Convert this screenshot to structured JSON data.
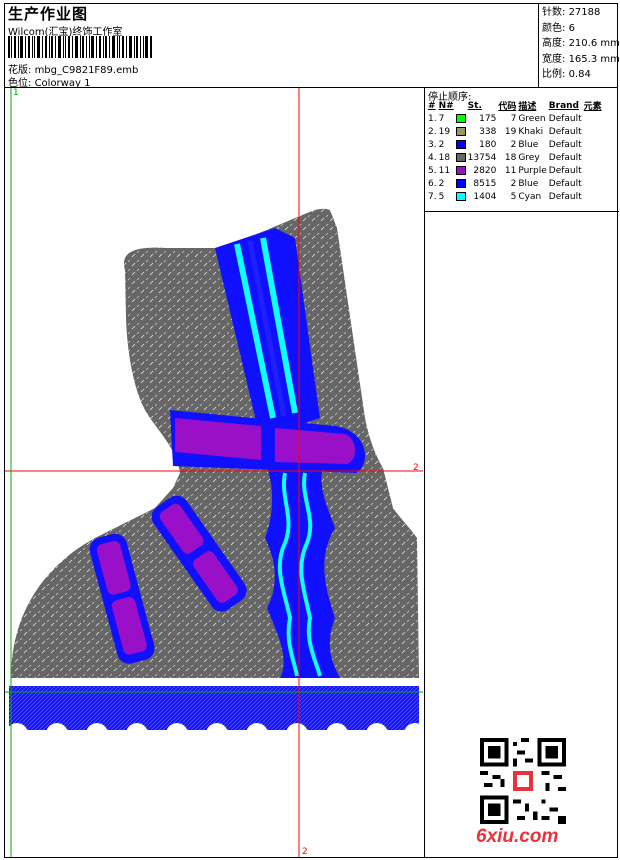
{
  "header": {
    "title": "生产作业图",
    "company": "Wilcom(汇宝)终饰工作室",
    "design_label": "花版:",
    "design_value": "mbg_C9821F89.emb",
    "colorway_label": "色位:",
    "colorway_value": "Colorway 1"
  },
  "stats": [
    {
      "label": "针数",
      "value": "27188"
    },
    {
      "label": "颜色",
      "value": "6"
    },
    {
      "label": "高度",
      "value": "210.6 mm"
    },
    {
      "label": "宽度",
      "value": "165.3 mm"
    },
    {
      "label": "比例",
      "value": "0.84"
    }
  ],
  "stop_sequence": {
    "title": "停止顺序:",
    "columns": [
      "#",
      "N#",
      "St.",
      "代码",
      "描述",
      "Brand",
      "元素"
    ],
    "rows": [
      {
        "idx": "1.",
        "n": "7",
        "color": "#00ff00",
        "st": "175",
        "code": "7",
        "desc": "Green",
        "brand": "Default"
      },
      {
        "idx": "2.",
        "n": "19",
        "color": "#9a9467",
        "st": "338",
        "code": "19",
        "desc": "Khaki",
        "brand": "Default"
      },
      {
        "idx": "3.",
        "n": "2",
        "color": "#0000ff",
        "st": "180",
        "code": "2",
        "desc": "Blue",
        "brand": "Default"
      },
      {
        "idx": "4.",
        "n": "18",
        "color": "#686868",
        "st": "13754",
        "code": "18",
        "desc": "Grey",
        "brand": "Default"
      },
      {
        "idx": "5.",
        "n": "11",
        "color": "#9b10c8",
        "st": "2820",
        "code": "11",
        "desc": "Purple",
        "brand": "Default"
      },
      {
        "idx": "6.",
        "n": "2",
        "color": "#0000ff",
        "st": "8515",
        "code": "2",
        "desc": "Blue",
        "brand": "Default"
      },
      {
        "idx": "7.",
        "n": "5",
        "color": "#00ffff",
        "st": "1404",
        "code": "5",
        "desc": "Cyan",
        "brand": "Default"
      }
    ]
  },
  "design": {
    "marker_1": "1",
    "marker_2_right": "2",
    "marker_2_bottom": "2",
    "colors": {
      "grey": "#666666",
      "blue": "#1010ff",
      "purple": "#9a10c8",
      "cyan": "#10ffff",
      "guide_red": "#ff0000",
      "guide_green": "#00aa00"
    }
  },
  "watermark": "6xiu.com"
}
